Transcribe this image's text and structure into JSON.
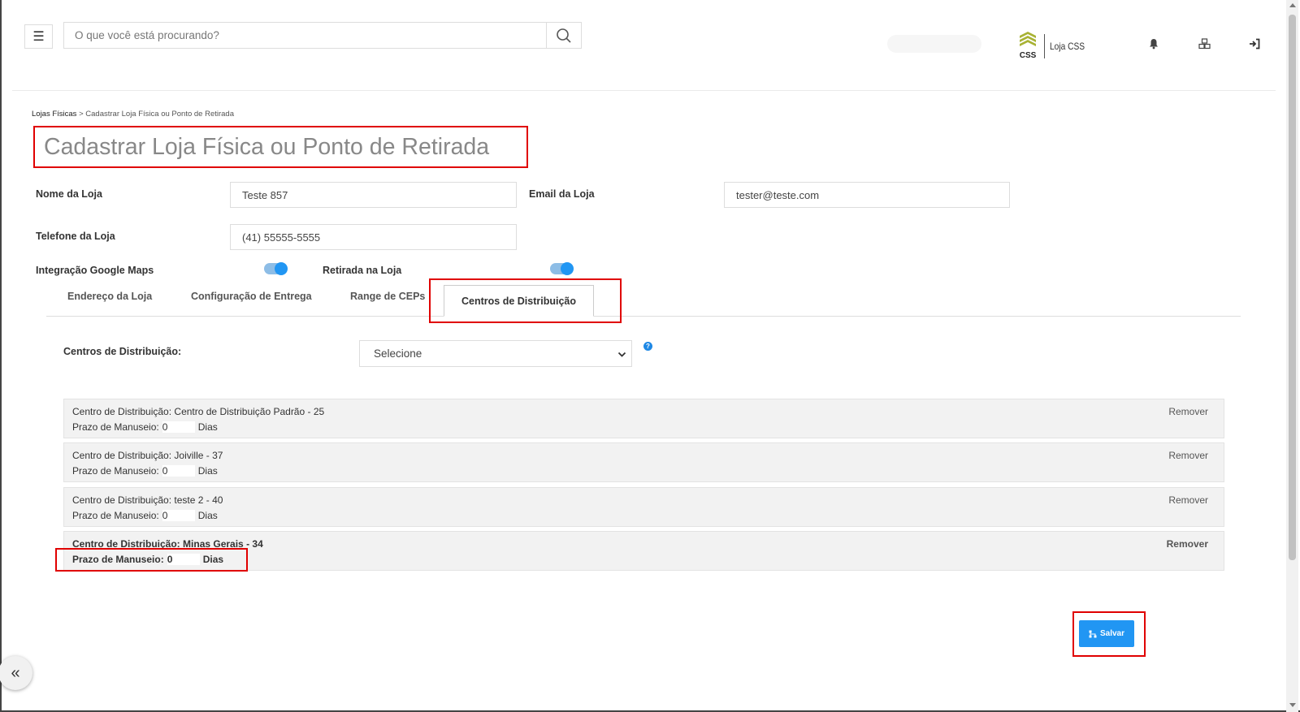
{
  "header": {
    "menu_icon": "hamburger-icon",
    "search_placeholder": "O que você está procurando?",
    "search_icon": "search-icon",
    "store_name": "Loja CSS",
    "logo_text": "CSS",
    "icons": [
      "bell-icon",
      "cubes-icon",
      "sign-in-icon"
    ]
  },
  "breadcrumb": {
    "root": "Lojas Físicas",
    "separator": ">",
    "current": "Cadastrar Loja Física ou Ponto de Retirada"
  },
  "page_title": "Cadastrar Loja Física ou Ponto de Retirada",
  "form": {
    "store_name_label": "Nome da Loja",
    "store_name_value": "Teste 857",
    "email_label": "Email da Loja",
    "email_value": "tester@teste.com",
    "phone_label": "Telefone da Loja",
    "phone_value": "(41) 55555-5555",
    "google_maps_label": "Integração Google Maps",
    "google_maps_enabled": true,
    "pickup_label": "Retirada na Loja",
    "pickup_enabled": true
  },
  "tabs": [
    {
      "label": "Endereço da Loja",
      "active": false
    },
    {
      "label": "Configuração de Entrega",
      "active": false
    },
    {
      "label": "Range de CEPs",
      "active": false
    },
    {
      "label": "Centros de Distribuição",
      "active": true
    }
  ],
  "distribution": {
    "label": "Centros de Distribuição:",
    "select_value": "Selecione",
    "help_icon": "question-circle-icon",
    "items": [
      {
        "prefix": "Centro de Distribuição:",
        "name": "Centro de Distribuição Padrão - 25",
        "prazo_label": "Prazo de Manuseio:",
        "prazo_value": "0",
        "unit": "Dias",
        "remove": "Remover"
      },
      {
        "prefix": "Centro de Distribuição:",
        "name": "Joiville - 37",
        "prazo_label": "Prazo de Manuseio:",
        "prazo_value": "0",
        "unit": "Dias",
        "remove": "Remover"
      },
      {
        "prefix": "Centro de Distribuição:",
        "name": "teste 2 - 40",
        "prazo_label": "Prazo de Manuseio:",
        "prazo_value": "0",
        "unit": "Dias",
        "remove": "Remover"
      },
      {
        "prefix": "Centro de Distribuição:",
        "name": "Minas Gerais - 34",
        "prazo_label": "Prazo de Manuseio:",
        "prazo_value": "0",
        "unit": "Dias",
        "remove": "Remover"
      }
    ]
  },
  "save_button": {
    "label": "Salvar",
    "icon": "sitemap-icon"
  },
  "collapse_button": {
    "label": "«"
  },
  "colors": {
    "accent": "#2196f3",
    "highlight": "#e00000",
    "toggle_track": "#8dbde6",
    "logo_green": "#a8b234"
  }
}
